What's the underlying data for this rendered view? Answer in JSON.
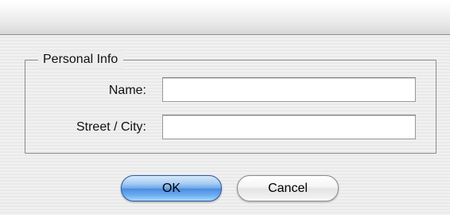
{
  "dialog": {
    "group_title": "Personal Info",
    "fields": [
      {
        "label": "Name:",
        "value": ""
      },
      {
        "label": "Street / City:",
        "value": ""
      }
    ],
    "buttons": {
      "ok_label": "OK",
      "cancel_label": "Cancel"
    }
  },
  "colors": {
    "default_button": "#6fa7e8",
    "window_background": "#ededed"
  }
}
